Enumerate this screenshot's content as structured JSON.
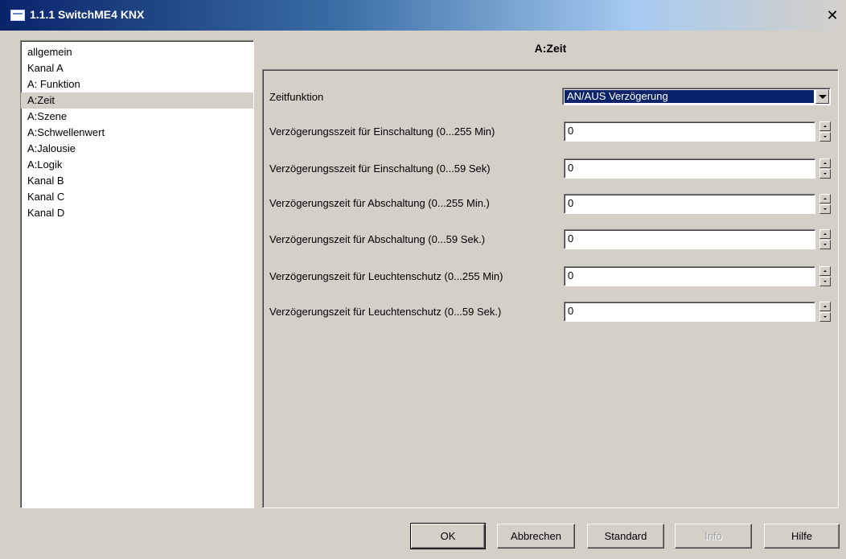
{
  "window": {
    "title": "1.1.1 SwitchME4 KNX",
    "close_label": "✕"
  },
  "nav": {
    "items": [
      {
        "label": "allgemein"
      },
      {
        "label": "Kanal A"
      },
      {
        "label": "A: Funktion"
      },
      {
        "label": "A:Zeit"
      },
      {
        "label": "A:Szene"
      },
      {
        "label": "A:Schwellenwert"
      },
      {
        "label": "A:Jalousie"
      },
      {
        "label": "A:Logik"
      },
      {
        "label": "Kanal B"
      },
      {
        "label": "Kanal C"
      },
      {
        "label": "Kanal D"
      }
    ],
    "selected": "A:Zeit"
  },
  "page": {
    "title": "A:Zeit"
  },
  "params": {
    "zeitfunktion": {
      "label": "Zeitfunktion",
      "value": "AN/AUS Verzögerung"
    },
    "fields": [
      {
        "label": "Verzögerungsszeit für Einschaltung (0...255 Min)",
        "value": "0"
      },
      {
        "label": "Verzögerungsszeit für Einschaltung (0...59 Sek)",
        "value": "0"
      },
      {
        "label": "Verzögerungszeit für Abschaltung (0...255 Min.)",
        "value": "0"
      },
      {
        "label": "Verzögerungszeit für Abschaltung (0...59 Sek.)",
        "value": "0"
      },
      {
        "label": "Verzögerungszeit für Leuchtenschutz (0...255 Min)",
        "value": "0"
      },
      {
        "label": "Verzögerungszeit für Leuchtenschutz (0...59 Sek.)",
        "value": "0"
      }
    ]
  },
  "buttons": {
    "ok": "OK",
    "cancel": "Abbrechen",
    "standard": "Standard",
    "info": "Info",
    "help": "Hilfe"
  }
}
